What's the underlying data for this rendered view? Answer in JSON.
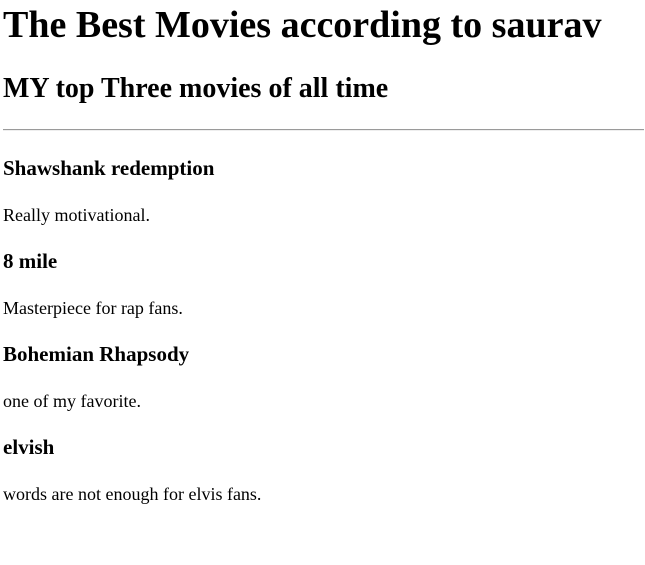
{
  "header": {
    "title": "The Best Movies according to saurav",
    "subtitle": "MY top Three movies of all time"
  },
  "movies": [
    {
      "name": "Shawshank redemption",
      "comment": "Really motivational."
    },
    {
      "name": "8 mile",
      "comment": "Masterpiece for rap fans."
    },
    {
      "name": "Bohemian Rhapsody",
      "comment": "one of my favorite."
    },
    {
      "name": "elvish",
      "comment": "words are not enough for elvis fans."
    }
  ]
}
